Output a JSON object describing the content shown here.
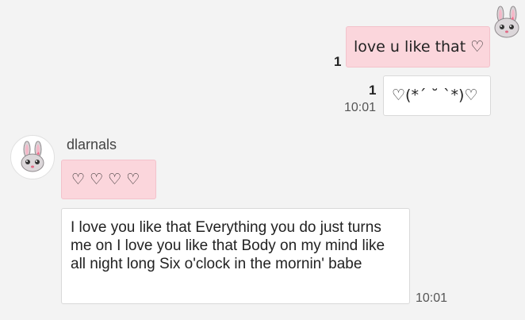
{
  "messages": {
    "out1": {
      "text": "love u like that ♡",
      "read_count": "1"
    },
    "out2": {
      "text": "♡(*´ ˘ `*)♡",
      "read_count": "1",
      "time": "10:01"
    },
    "in_sender": "dlarnals",
    "in1": {
      "text": "♡ ♡ ♡ ♡"
    },
    "in2": {
      "text": "I love you like that Everything you do just turns me on I love you like that Body on my mind like all night long Six o'clock in the mornin' babe",
      "time": "10:01"
    }
  },
  "colors": {
    "pink_bubble": "#fbd6dc",
    "white_bubble": "#ffffff",
    "background": "#f3f3f3"
  },
  "icons": {
    "avatar": "bunny-emoji-icon"
  }
}
